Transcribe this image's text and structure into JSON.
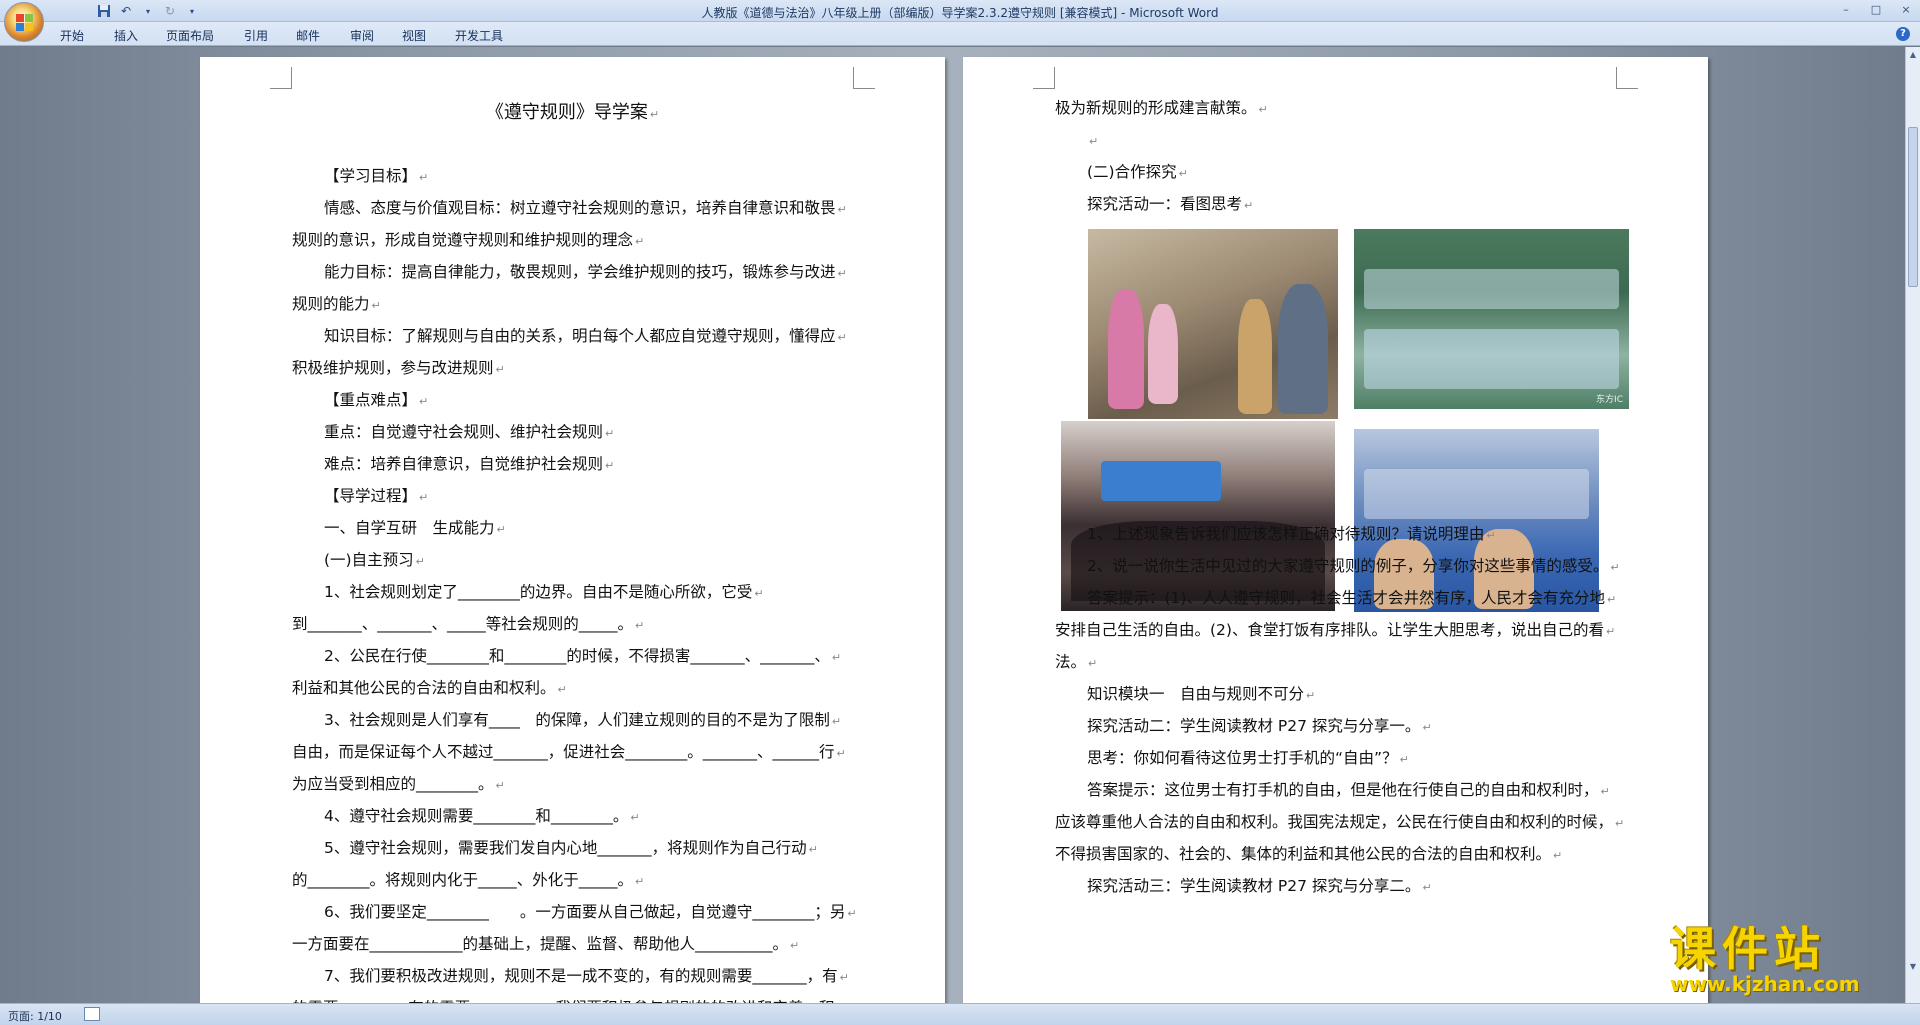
{
  "window": {
    "title": "人教版《道德与法治》八年级上册（部编版）导学案2.3.2遵守规则 [兼容模式] - Microsoft Word",
    "controls": [
      "–",
      "□",
      "×"
    ]
  },
  "qat": {
    "save_icon": "save-icon",
    "undo_icon": "undo-icon",
    "redo_icon": "redo-icon",
    "customize_icon": "dropdown-icon"
  },
  "ribbon": {
    "tabs": [
      "开始",
      "插入",
      "页面布局",
      "引用",
      "邮件",
      "审阅",
      "视图",
      "开发工具"
    ]
  },
  "page1": {
    "title": "《遵守规则》导学案",
    "lines": [
      {
        "text": "【学习目标】",
        "indent": true
      },
      {
        "text": "情感、态度与价值观目标：树立遵守社会规则的意识，培养自律意识和敬畏",
        "indent": true
      },
      {
        "text": "规则的意识，形成自觉遵守规则和维护规则的理念",
        "indent": false
      },
      {
        "text": "能力目标：提高自律能力，敬畏规则，学会维护规则的技巧，锻炼参与改进",
        "indent": true
      },
      {
        "text": "规则的能力",
        "indent": false
      },
      {
        "text": "知识目标：了解规则与自由的关系，明白每个人都应自觉遵守规则，懂得应",
        "indent": true
      },
      {
        "text": "积极维护规则，参与改进规则",
        "indent": false
      },
      {
        "text": "【重点难点】",
        "indent": true
      },
      {
        "text": "重点：自觉遵守社会规则、维护社会规则",
        "indent": true
      },
      {
        "text": "难点：培养自律意识，自觉维护社会规则",
        "indent": true
      },
      {
        "text": "【导学过程】",
        "indent": true
      },
      {
        "text": "一、自学互研　生成能力",
        "indent": true
      },
      {
        "text": "(一)自主预习",
        "indent": true
      },
      {
        "text": "1、社会规则划定了________的边界。自由不是随心所欲，它受",
        "indent": true
      },
      {
        "text": "到_______、_______、_____等社会规则的_____。",
        "indent": false
      },
      {
        "text": "2、公民在行使________和________的时候，不得损害_______、_______、",
        "indent": true
      },
      {
        "text": "利益和其他公民的合法的自由和权利。",
        "indent": false
      },
      {
        "text": "3、社会规则是人们享有____　的保障，人们建立规则的目的不是为了限制",
        "indent": true
      },
      {
        "text": "自由，而是保证每个人不越过_______，促进社会________。_______、______行",
        "indent": false
      },
      {
        "text": "为应当受到相应的________。",
        "indent": false
      },
      {
        "text": "4、遵守社会规则需要________和________。",
        "indent": true
      },
      {
        "text": "5、遵守社会规则，需要我们发自内心地_______，将规则作为自己行动",
        "indent": true
      },
      {
        "text": "的________。将规则内化于_____、外化于_____。",
        "indent": false
      },
      {
        "text": "6、我们要坚定________　　。一方面要从自己做起，自觉遵守________；另",
        "indent": true
      },
      {
        "text": "一方面要在____________的基础上，提醒、监督、帮助他人__________。",
        "indent": false
      },
      {
        "text": "7、我们要积极改进规则，规则不是一成不变的，有的规则需要_______，有",
        "indent": true
      },
      {
        "text": "的需要_______，有的需要_________。我们要积极参与规则的的改进和完善，积",
        "indent": false
      }
    ]
  },
  "page2": {
    "top_lines": [
      {
        "text": "极为新规则的形成建言献策。",
        "indent": false
      },
      {
        "text": "",
        "indent": true
      },
      {
        "text": "(二)合作探究",
        "indent": true
      },
      {
        "text": "探究活动一：看图思考",
        "indent": true
      }
    ],
    "photos": [
      {
        "name": "photo-students-queue-stairs"
      },
      {
        "name": "photo-factory-workers",
        "credit": "东方IC"
      },
      {
        "name": "photo-assembly-hall"
      },
      {
        "name": "photo-classroom-students"
      }
    ],
    "bottom_lines": [
      {
        "text": "1、上述现象告诉我们应该怎样正确对待规则？请说明理由",
        "indent": true
      },
      {
        "text": "2、说一说你生活中见过的大家遵守规则的例子，分享你对这些事情的感受。",
        "indent": true
      },
      {
        "text": "答案提示：(1)、人人遵守规则，社会生活才会井然有序，人民才会有充分地",
        "indent": true
      },
      {
        "text": "安排自己生活的自由。(2)、食堂打饭有序排队。让学生大胆思考，说出自己的看",
        "indent": false
      },
      {
        "text": "法。",
        "indent": false
      },
      {
        "text": "知识模块一　自由与规则不可分",
        "indent": true
      },
      {
        "text": "探究活动二：学生阅读教材 P27 探究与分享一。",
        "indent": true
      },
      {
        "text": "思考：你如何看待这位男士打手机的“自由”？",
        "indent": true
      },
      {
        "text": "答案提示：这位男士有打手机的自由，但是他在行使自己的自由和权利时，",
        "indent": true
      },
      {
        "text": "应该尊重他人合法的自由和权利。我国宪法规定，公民在行使自由和权利的时候，",
        "indent": false
      },
      {
        "text": "不得损害国家的、社会的、集体的利益和其他公民的合法的自由和权利。",
        "indent": false
      },
      {
        "text": "探究活动三：学生阅读教材 P27 探究与分享二。",
        "indent": true
      }
    ]
  },
  "statusbar": {
    "page_info": "页面: 1/10"
  },
  "brand": {
    "name": "课件站",
    "url": "www.kjzhan.com"
  },
  "colors": {
    "accent": "#2c69c4",
    "brand_yellow": "#f5d400"
  }
}
